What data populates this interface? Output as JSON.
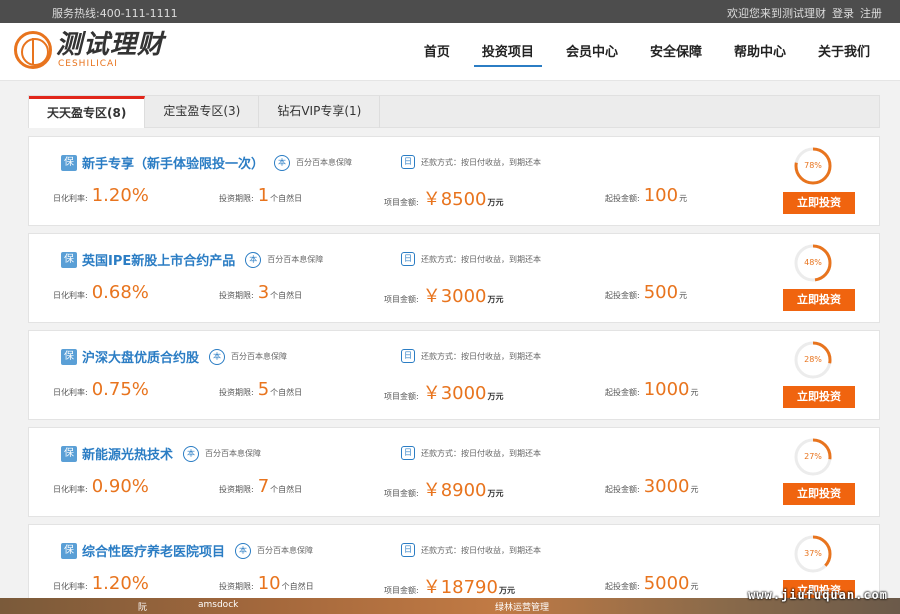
{
  "topbar": {
    "hotline": "服务热线:400-111-1111",
    "welcome": "欢迎您来到测试理财",
    "login": "登录",
    "register": "注册"
  },
  "logo": {
    "cn": "测试理财",
    "en": "CESHILICAI"
  },
  "nav": [
    {
      "label": "首页",
      "active": false
    },
    {
      "label": "投资项目",
      "active": true
    },
    {
      "label": "会员中心",
      "active": false
    },
    {
      "label": "安全保障",
      "active": false
    },
    {
      "label": "帮助中心",
      "active": false
    },
    {
      "label": "关于我们",
      "active": false
    }
  ],
  "tabs": [
    {
      "label": "天天盈专区(8)",
      "active": true
    },
    {
      "label": "定宝盈专区(3)",
      "active": false
    },
    {
      "label": "钻石VIP专享(1)",
      "active": false
    }
  ],
  "labels": {
    "badge": "保",
    "ben": "本",
    "guarantee": "百分百本息保障",
    "repay_icon": "日",
    "repay": "还款方式：按日付收益，到期还本",
    "rate": "日化利率:",
    "term": "投资期限:",
    "term_unit": "个自然日",
    "amount": "项目金额:",
    "amount_unit": "万元",
    "min": "起投金额:",
    "min_unit": "元",
    "invest": "立即投资",
    "currency": "￥"
  },
  "products": [
    {
      "title": "新手专享（新手体验限投一次）",
      "rate": "1.20%",
      "term": "1",
      "amount": "8500",
      "min": "100",
      "progress": 78,
      "progress_label": "78%"
    },
    {
      "title": "英国IPE新股上市合约产品",
      "rate": "0.68%",
      "term": "3",
      "amount": "3000",
      "min": "500",
      "progress": 48,
      "progress_label": "48%"
    },
    {
      "title": "沪深大盘优质合约股",
      "rate": "0.75%",
      "term": "5",
      "amount": "3000",
      "min": "1000",
      "progress": 28,
      "progress_label": "28%"
    },
    {
      "title": "新能源光热技术",
      "rate": "0.90%",
      "term": "7",
      "amount": "8900",
      "min": "3000",
      "progress": 27,
      "progress_label": "27%"
    },
    {
      "title": "综合性医疗养老医院项目",
      "rate": "1.20%",
      "term": "10",
      "amount": "18790",
      "min": "5000",
      "progress": 37,
      "progress_label": "37%"
    }
  ],
  "colors": {
    "accent": "#e8741e",
    "button": "#f0640f",
    "link": "#2b7dc4",
    "tab_active": "#e1261b"
  },
  "taskbar": {
    "items": [
      "阮",
      "amsdock",
      "绿林运营管理"
    ]
  },
  "watermark": "www.jiufuquan.com"
}
